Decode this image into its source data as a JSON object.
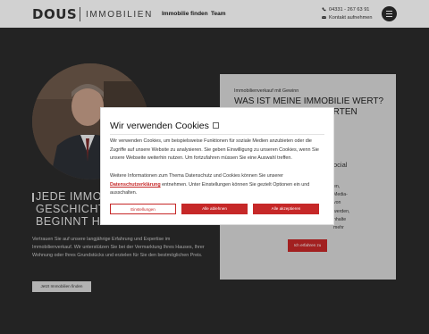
{
  "header": {
    "logo": {
      "brand": "DOUS",
      "suffix": "IMMOBILIEN"
    },
    "nav": [
      {
        "label": "Immobilie finden"
      },
      {
        "label": "Team"
      }
    ],
    "contact": {
      "phone": "04331 - 267 63 91",
      "email_label": "Kontakt aufnehmen"
    },
    "menu_icon": "hamburger-menu-icon"
  },
  "hero": {
    "heading_lines": [
      "JEDE IMMO",
      "GESCHICHT",
      "BEGINNT H"
    ],
    "intro": "Vertrauen Sie auf unsere langjährige Erfahrung und Expertise im Immobilienverkauf. Wir unterstützen Sie bei der Vermarktung Ihres Hauses, Ihrer Wohnung oder Ihres Grundstücks und erzielen für Sie den bestmöglichen Preis.",
    "button": "Jetzt Immobilien finden"
  },
  "valuation_card": {
    "kicker": "Immobilienverkauf mit Gewinn",
    "title": "WAS IST MEINE IMMOBILIE WERT?",
    "title_line2_fragment": "ERTEN",
    "sub_fragment": "ocial",
    "line_fragments": [
      "en,",
      "Media-",
      "von",
      "werden,",
      "nhalte",
      "mehr"
    ],
    "button": "Ich erfahren zu"
  },
  "cookie_modal": {
    "title": "Wir verwenden Cookies",
    "paragraph1": "Wir verwenden Cookies, um beispielsweise Funktionen für soziale Medien anzubieten oder die Zugriffe auf unsere Website zu analysieren. Sie geben Einwilligung zu unseren Cookies, wenn Sie unsere Webseite weiterhin nutzen. Um fortzufahren müssen Sie eine Auswahl treffen.",
    "paragraph2_before": "Weitere Informationen zum Thema Datenschutz und Cookies können Sie unserer ",
    "privacy_link": "Datenschutzerklärung",
    "paragraph2_after": " entnehmen. Unter Einstellungen können Sie gezielt Optionen ein und ausschalten.",
    "buttons": {
      "settings": "Einstellungen",
      "reject": "Alle ablehnen",
      "accept": "Alle akzeptieren"
    }
  },
  "colors": {
    "accent": "#c62828",
    "dark_bg": "#2b2b2b",
    "card_bg": "#d9d9d9"
  }
}
